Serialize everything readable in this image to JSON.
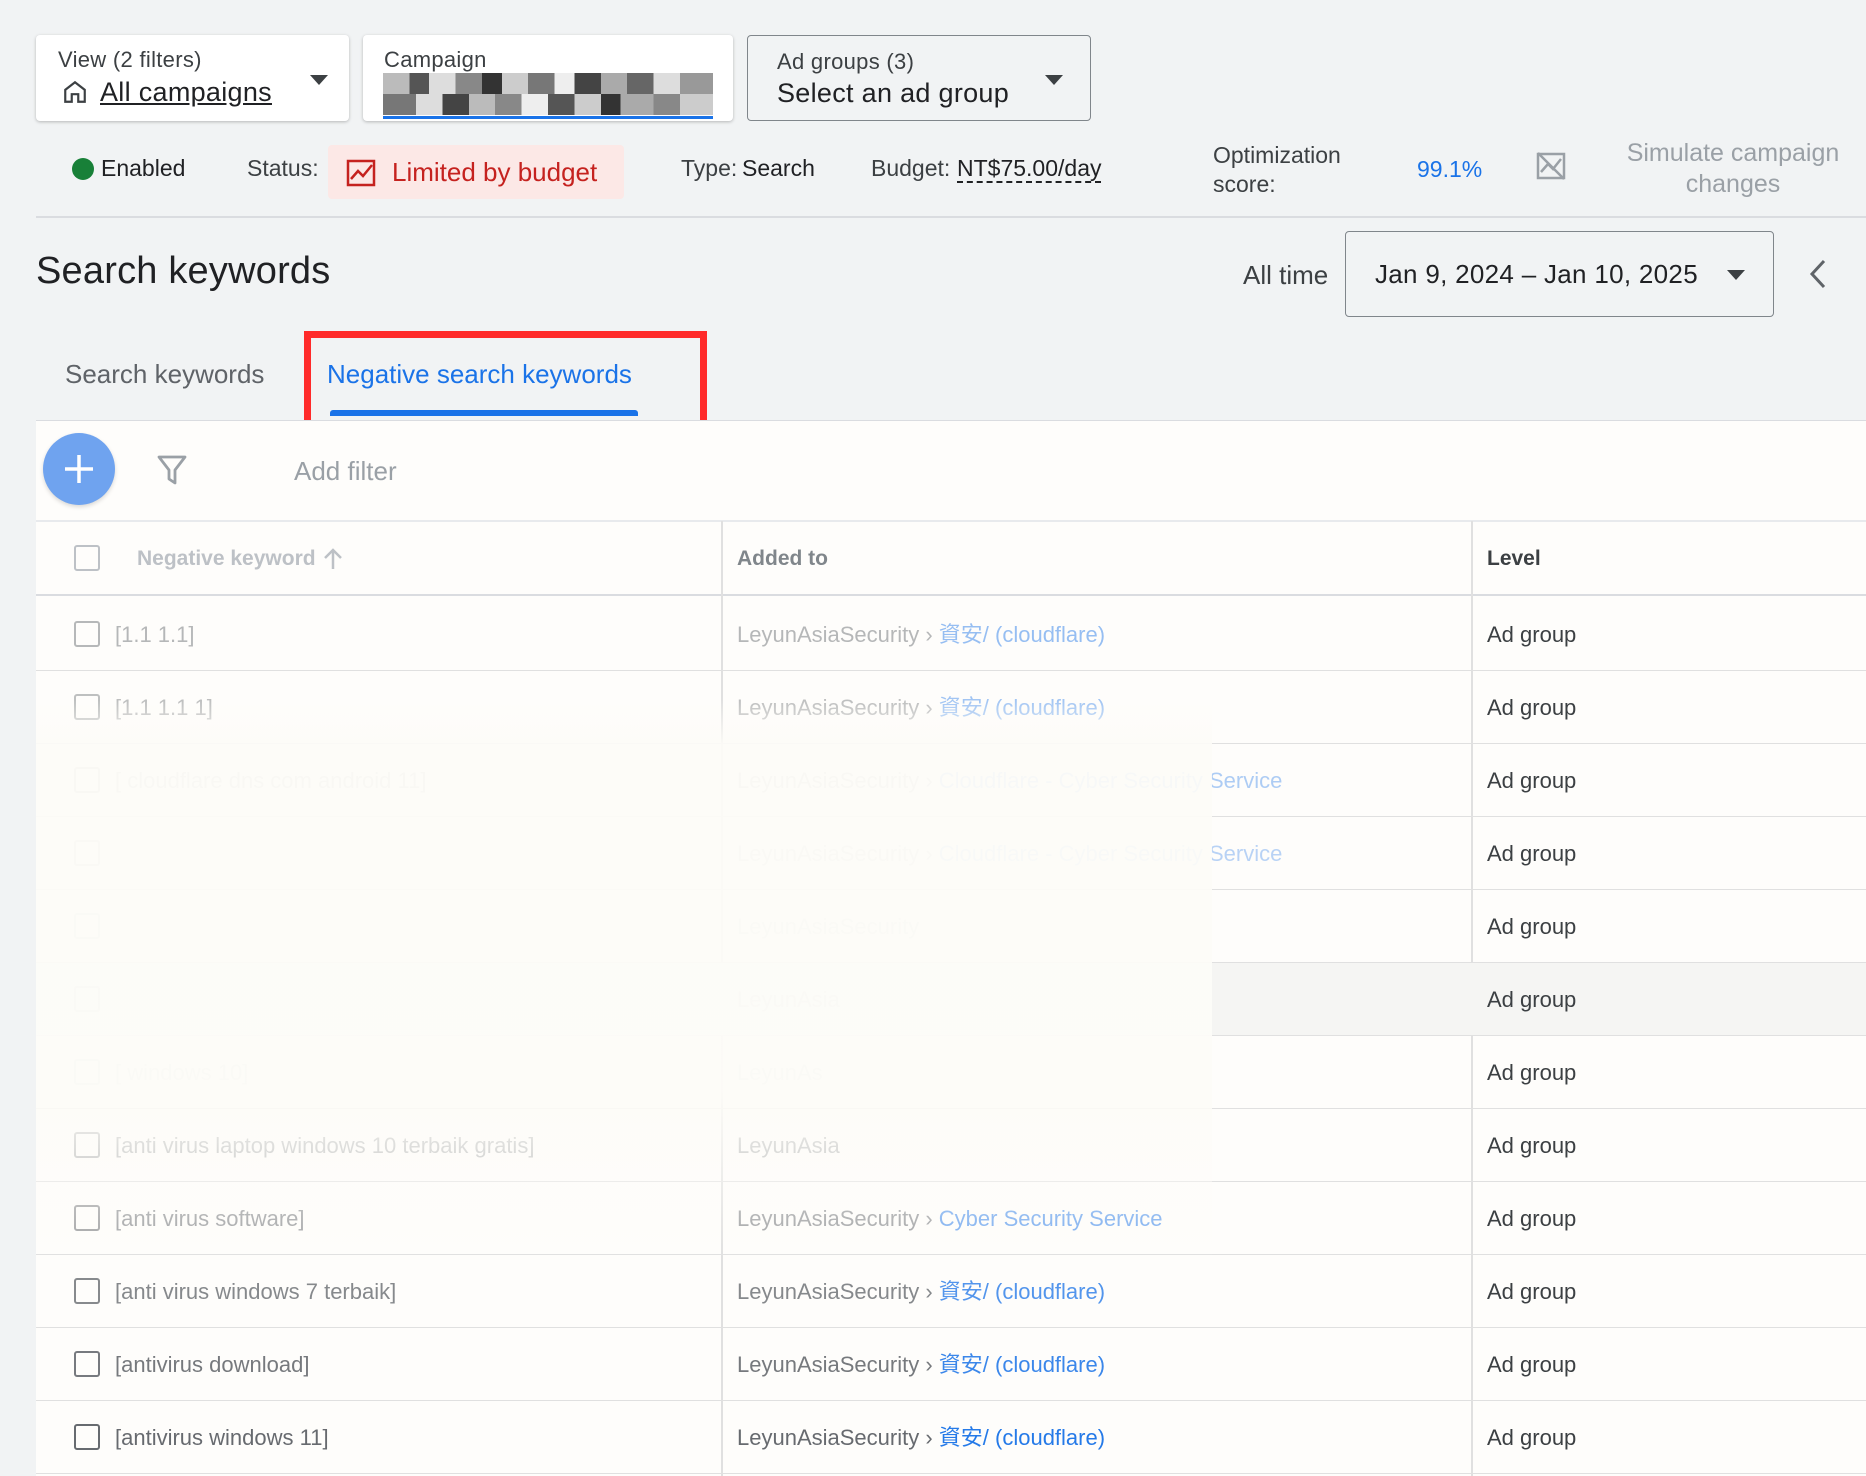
{
  "top_selectors": {
    "view": {
      "small": "View (2 filters)",
      "value": "All campaigns"
    },
    "campaign": {
      "small": "Campaign"
    },
    "ad_groups": {
      "small": "Ad groups (3)",
      "value": "Select an ad group"
    }
  },
  "status_bar": {
    "enabled": "Enabled",
    "status_label": "Status:",
    "status_value": "Limited by budget",
    "type_label": "Type:",
    "type_value": "Search",
    "budget_label": "Budget:",
    "budget_value": "NT$75.00/day",
    "optimization_label_1": "Optimization",
    "optimization_label_2": "score:",
    "optimization_value": "99.1%",
    "simulate_1": "Simulate campaign",
    "simulate_2": "changes"
  },
  "page": {
    "title": "Search keywords",
    "range_label": "All time",
    "date_range": "Jan 9, 2024 – Jan 10, 2025"
  },
  "tabs": [
    {
      "label": "Search keywords",
      "active": false
    },
    {
      "label": "Negative search keywords",
      "active": true
    }
  ],
  "toolbar": {
    "add_filter": "Add filter"
  },
  "table": {
    "columns": [
      "Negative keyword",
      "Added to",
      "Level"
    ],
    "rows": [
      {
        "keyword": "[1.1 1.1]",
        "account": "LeyunAsiaSecurity",
        "group": "資安/ (cloudflare)",
        "level": "Ad group"
      },
      {
        "keyword": "[1.1 1.1 1]",
        "account": "LeyunAsiaSecurity",
        "group": "資安/ (cloudflare)",
        "level": "Ad group"
      },
      {
        "keyword": "[                    cloudflare dns com android 11]",
        "account": "LeyunAsiaSecurity",
        "group": "Cloudflare - Cyber Security Service",
        "level": "Ad group"
      },
      {
        "keyword": "",
        "account": "LeyunAsiaSecurity",
        "group": "Cloudflare - Cyber Security Service",
        "level": "Ad group"
      },
      {
        "keyword": "",
        "account": "LeyunAsiaSecurity",
        "group": "",
        "level": "Ad group"
      },
      {
        "keyword": "",
        "account": "LeyunAsia",
        "group": "",
        "level": "Ad group"
      },
      {
        "keyword": "[                         windows 10]",
        "account": "LeyunAs",
        "group": "",
        "level": "Ad group"
      },
      {
        "keyword": "[anti virus laptop windows 10 terbaik gratis]",
        "account": "LeyunAsia",
        "group": "",
        "level": "Ad group"
      },
      {
        "keyword": "[anti virus software]",
        "account": "LeyunAsiaSecurity",
        "group": "Cyber Security Service",
        "level": "Ad group"
      },
      {
        "keyword": "[anti virus windows 7 terbaik]",
        "account": "LeyunAsiaSecurity",
        "group": "資安/ (cloudflare)",
        "level": "Ad group"
      },
      {
        "keyword": "[antivirus download]",
        "account": "LeyunAsiaSecurity",
        "group": "資安/ (cloudflare)",
        "level": "Ad group"
      },
      {
        "keyword": "[antivirus windows 11]",
        "account": "LeyunAsiaSecurity",
        "group": "資安/ (cloudflare)",
        "level": "Ad group"
      }
    ]
  },
  "colors": {
    "accent_blue": "#1a73e8",
    "status_red": "#c5221f",
    "status_bg": "#fce8e6",
    "enabled_green": "#188038",
    "highlight_box": "#ff2a2a"
  }
}
